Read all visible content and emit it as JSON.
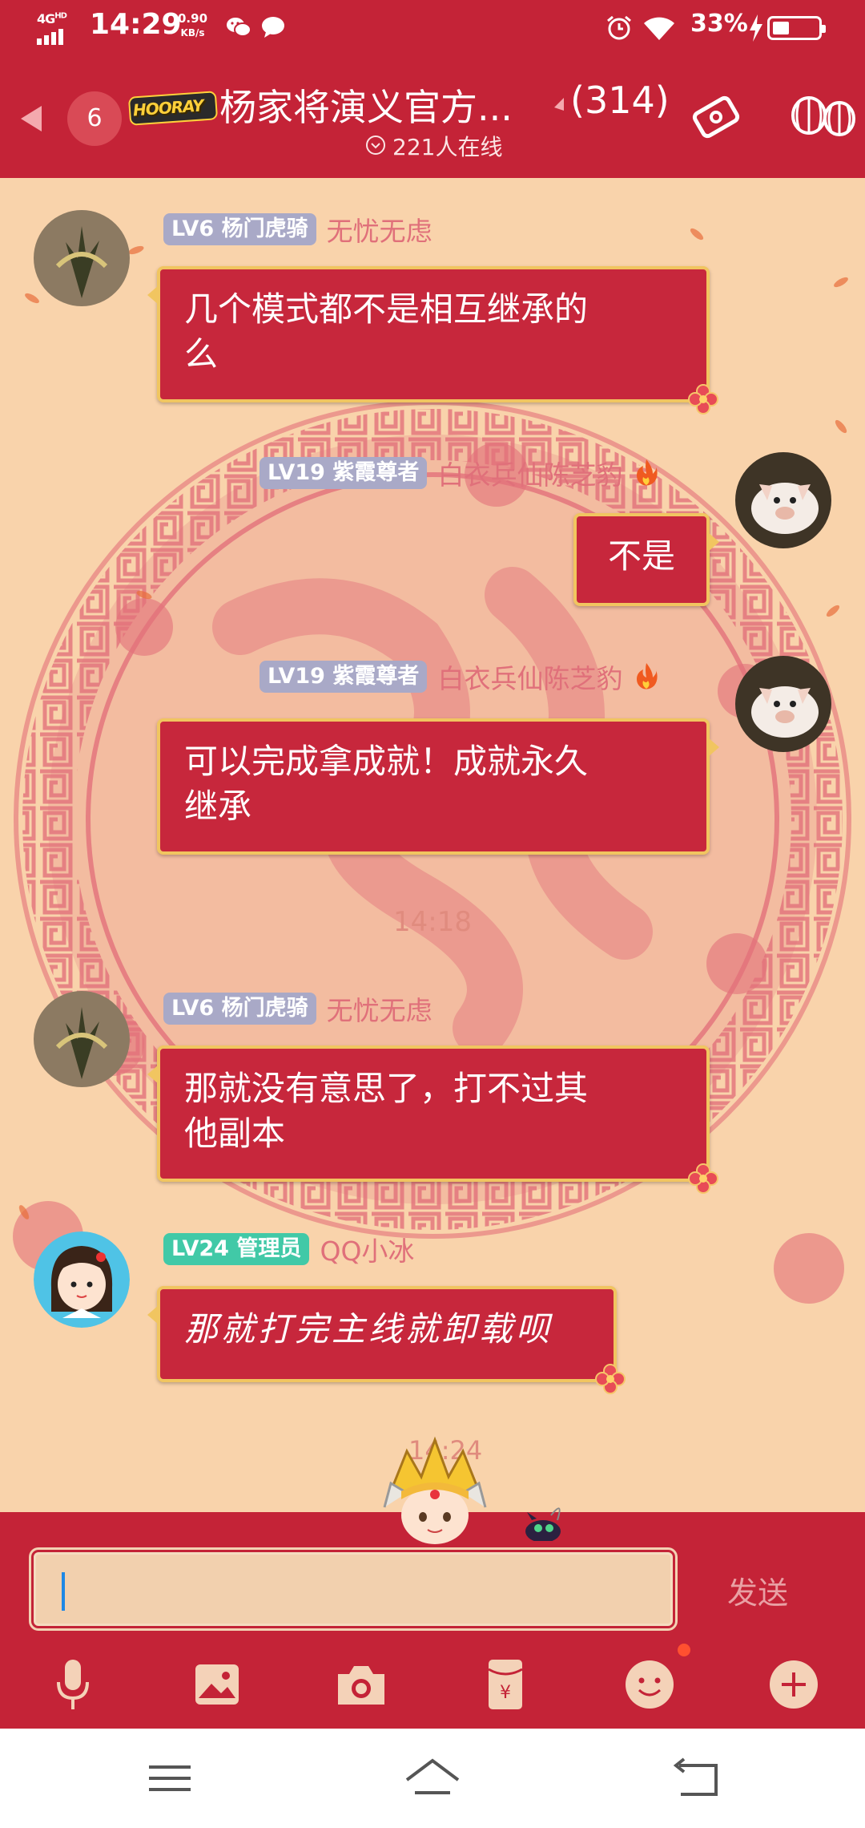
{
  "status_bar": {
    "network": "4G",
    "network_sup": "HD",
    "time": "14:29",
    "speed_value": "0.90",
    "speed_unit": "KB/s",
    "battery": "33%"
  },
  "header": {
    "unread_count": "6",
    "logo_text": "HOORAY",
    "group_title": "杨家将演义官方...",
    "member_count": "(314)",
    "online": "221人在线"
  },
  "messages": [
    {
      "side": "left",
      "level": "LV6",
      "title": "杨门虎骑",
      "nick": "无忧无虑",
      "text_line1": "几个模式都不是相互继承的",
      "text_line2": "么"
    },
    {
      "side": "right",
      "level": "LV19",
      "title": "紫霞尊者",
      "nick": "白衣兵仙陈芝豹",
      "text_line1": "不是"
    },
    {
      "side": "right",
      "level": "LV19",
      "title": "紫霞尊者",
      "nick": "白衣兵仙陈芝豹",
      "text_line1": "可以完成拿成就！成就永久",
      "text_line2": "继承"
    },
    {
      "side": "left",
      "level": "LV6",
      "title": "杨门虎骑",
      "nick": "无忧无虑",
      "text_line1": "那就没有意思了，打不过其",
      "text_line2": "他副本"
    },
    {
      "side": "left",
      "level": "LV24",
      "title": "管理员",
      "nick": "QQ小冰",
      "text_line1": "那就打完主线就卸载呗"
    }
  ],
  "timestamps": [
    "14:18",
    "14:24"
  ],
  "input": {
    "send_label": "发送"
  },
  "toolbar_icons": [
    "microphone-icon",
    "image-icon",
    "camera-icon",
    "red-packet-icon",
    "emoji-icon",
    "plus-icon"
  ],
  "colors": {
    "header_bg": "#c42337",
    "bubble_bg": "#c7273c",
    "bubble_border": "#f1c560",
    "chat_bg": "#f9d3ab"
  }
}
